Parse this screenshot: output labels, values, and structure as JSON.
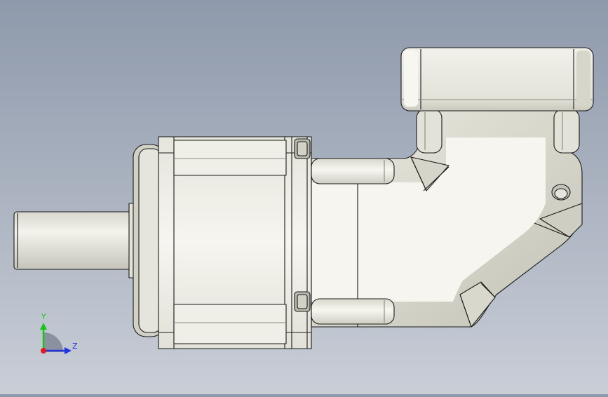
{
  "viewport": {
    "background_top": "#8e99ab",
    "background_bottom": "#c9ced7"
  },
  "model": {
    "part_color": "#ecebe3",
    "shade_color": "#c9c8be",
    "edge_color": "#1a1a1a"
  },
  "triad": {
    "y_label": "Y",
    "z_label": "Z",
    "y_color": "#19c419",
    "z_color": "#2233dd",
    "x_color": "#e01b1b"
  }
}
